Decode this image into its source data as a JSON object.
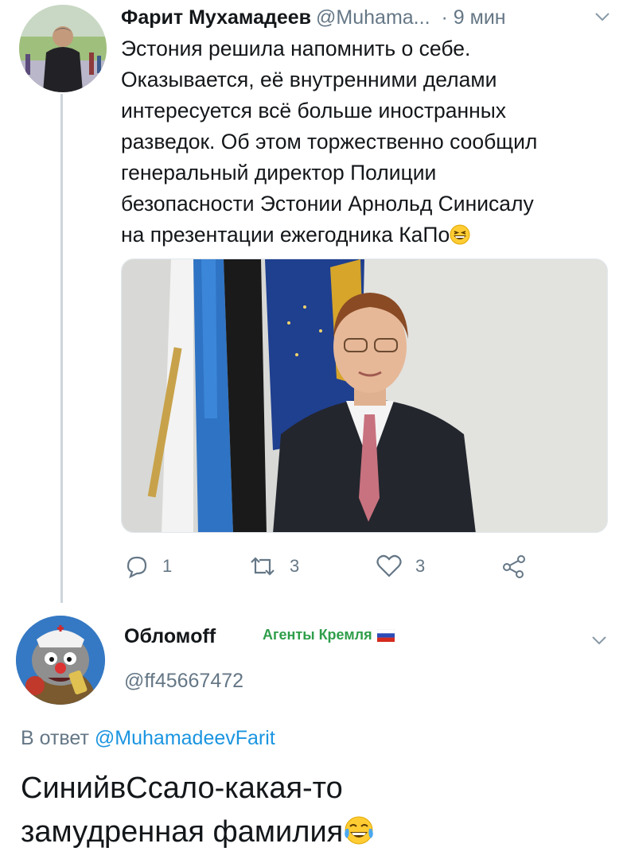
{
  "tweet": {
    "author_name": "Фарит Мухамадеев",
    "author_handle": "@Muhama...",
    "time": "· 9 мин",
    "text_lines": [
      "Эстония решила напомнить о себе.",
      "Оказывается, её внутренними делами",
      "интересуется всё больше иностранных",
      "разведок. Об этом торжественно сообщил",
      "генеральный директор Полиции",
      "безопасности Эстонии Арнольд Синисалу",
      "на презентации ежегодника КаПо"
    ],
    "emoji": "grinning-squinting-face",
    "actions": {
      "reply_count": "1",
      "retweet_count": "3",
      "like_count": "3"
    }
  },
  "reply": {
    "author_name": "Обломoff",
    "badge": "Агенты Кремля",
    "badge_flag": "russian-flag",
    "author_handle": "@ff45667472",
    "reply_prefix": "В ответ",
    "reply_to_handle": "@MuhamadeevFarit",
    "text_lines": [
      "СинийвСсало-какая-то",
      "замудренная фамилия"
    ],
    "emoji": "face-with-tears-of-joy"
  },
  "colors": {
    "text": "#14171a",
    "secondary": "#657786",
    "link": "#1b95e0",
    "badge": "#2f9e4a",
    "thread_line": "#ccd6dd"
  }
}
